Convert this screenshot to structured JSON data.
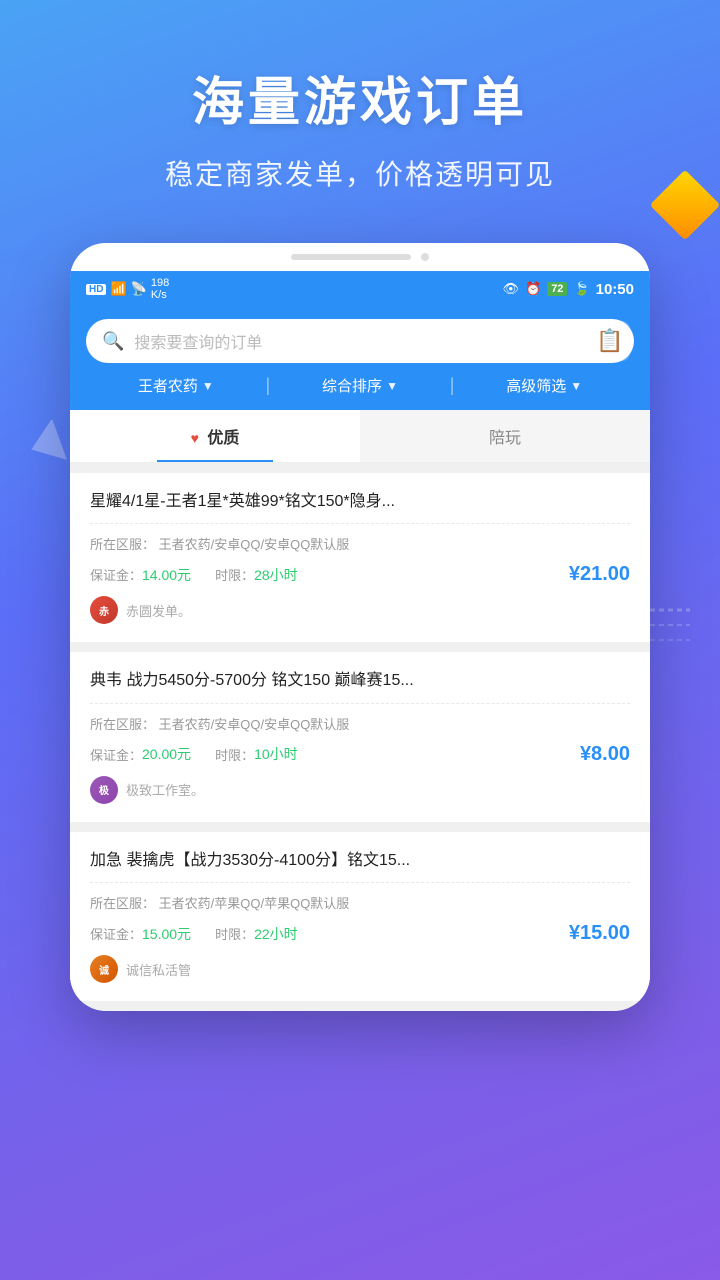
{
  "hero": {
    "title": "海量游戏订单",
    "subtitle": "稳定商家发单，价格透明可见"
  },
  "status_bar": {
    "left": "HD 4G  198 K/s",
    "time": "10:50",
    "battery": "72"
  },
  "search": {
    "placeholder": "搜索要查询的订单"
  },
  "filters": [
    {
      "label": "王者农药",
      "has_chevron": true
    },
    {
      "label": "综合排序",
      "has_chevron": true
    },
    {
      "label": "高级筛选",
      "has_chevron": true
    }
  ],
  "tabs": [
    {
      "label": "优质",
      "active": true,
      "icon": "heart"
    },
    {
      "label": "陪玩",
      "active": false
    }
  ],
  "cards": [
    {
      "title": "星耀4/1星-王者1星*英雄99*铭文150*隐身...",
      "region_label": "所在区服：",
      "region_value": "王者农药/安卓QQ/安卓QQ默认服",
      "deposit_label": "保证金：",
      "deposit_value": "14.00元",
      "time_label": "时限：",
      "time_value": "28小时",
      "price": "¥21.00",
      "author": "赤圆发单。",
      "avatar_color": "#e74c3c"
    },
    {
      "title": "典韦  战力5450分-5700分  铭文150 巅峰赛15...",
      "region_label": "所在区服：",
      "region_value": "王者农药/安卓QQ/安卓QQ默认服",
      "deposit_label": "保证金：",
      "deposit_value": "20.00元",
      "time_label": "时限：",
      "time_value": "10小时",
      "price": "¥8.00",
      "author": "极致工作室。",
      "avatar_color": "#9b59b6"
    },
    {
      "title": "加急  裴擒虎【战力3530分-4100分】铭文15...",
      "region_label": "所在区服：",
      "region_value": "王者农药/苹果QQ/苹果QQ默认服",
      "deposit_label": "保证金：",
      "deposit_value": "15.00元",
      "time_label": "时限：",
      "time_value": "22小时",
      "price": "¥15.00",
      "author": "诚信私活管",
      "avatar_color": "#e67e22"
    }
  ]
}
